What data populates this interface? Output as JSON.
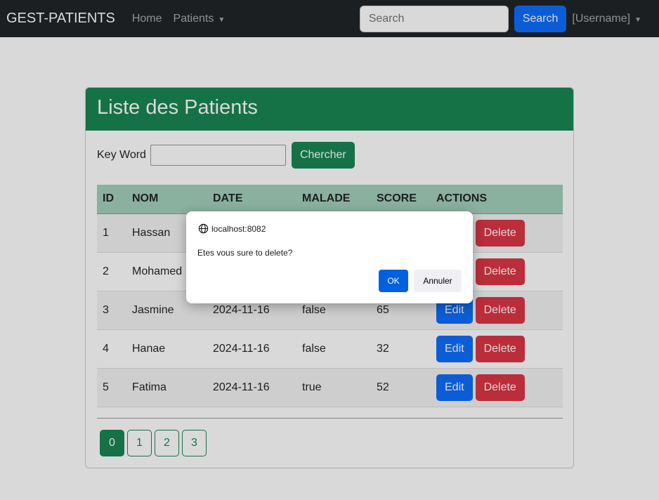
{
  "navbar": {
    "brand": "GEST-PATIENTS",
    "home": "Home",
    "patients": "Patients",
    "search_placeholder": "Search",
    "search_button": "Search",
    "user": "[Username]"
  },
  "card": {
    "title": "Liste des Patients",
    "keyword_label": "Key Word",
    "keyword_value": "",
    "search_button": "Chercher"
  },
  "table": {
    "headers": [
      "ID",
      "NOM",
      "DATE",
      "MALADE",
      "SCORE",
      "ACTIONS"
    ],
    "rows": [
      {
        "id": "1",
        "nom": "Hassan",
        "date": "",
        "malade": "",
        "score": ""
      },
      {
        "id": "2",
        "nom": "Mohamed",
        "date": "",
        "malade": "",
        "score": ""
      },
      {
        "id": "3",
        "nom": "Jasmine",
        "date": "2024-11-16",
        "malade": "false",
        "score": "65"
      },
      {
        "id": "4",
        "nom": "Hanae",
        "date": "2024-11-16",
        "malade": "false",
        "score": "32"
      },
      {
        "id": "5",
        "nom": "Fatima",
        "date": "2024-11-16",
        "malade": "true",
        "score": "52"
      }
    ],
    "edit": "Edit",
    "delete": "Delete"
  },
  "pagination": {
    "pages": [
      "0",
      "1",
      "2",
      "3"
    ],
    "current": "0"
  },
  "dialog": {
    "origin": "localhost:8082",
    "message": "Etes vous sure to delete?",
    "ok": "OK",
    "cancel": "Annuler"
  }
}
